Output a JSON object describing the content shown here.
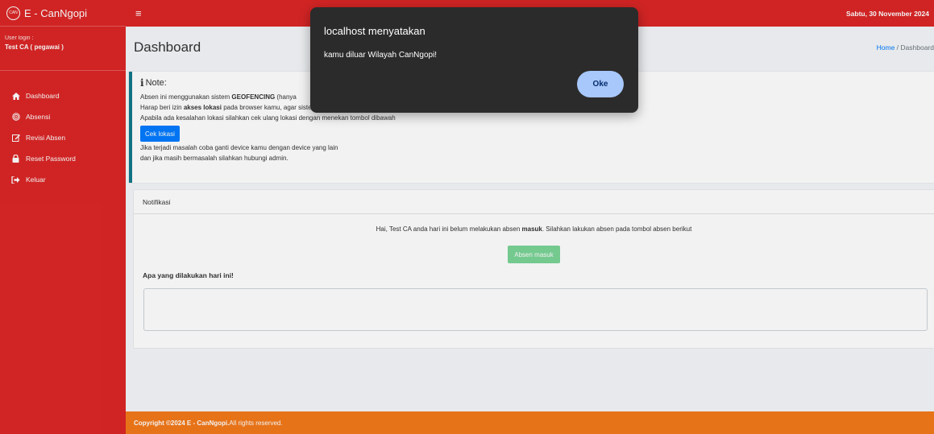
{
  "brand": {
    "name": "E - CanNgopi",
    "logo_text": "CAN"
  },
  "user": {
    "label": "User login :",
    "name": "Test CA ( pegawai )"
  },
  "nav": [
    {
      "label": "Dashboard",
      "icon": "home-icon"
    },
    {
      "label": "Absensi",
      "icon": "fingerprint-icon"
    },
    {
      "label": "Revisi Absen",
      "icon": "edit-icon"
    },
    {
      "label": "Reset Password",
      "icon": "lock-icon"
    },
    {
      "label": "Keluar",
      "icon": "sign-out-icon"
    }
  ],
  "topbar": {
    "date": "Sabtu, 30 November 2024"
  },
  "header": {
    "title": "Dashboard",
    "breadcrumb_home": "Home",
    "breadcrumb_sep": " / ",
    "breadcrumb_current": "Dashboard"
  },
  "note": {
    "title": "Note:",
    "line1_a": "Absen ini menggunakan sistem ",
    "line1_b": "GEOFENCING",
    "line1_c": " (hanya",
    "line2_a": "Harap beri izin ",
    "line2_b": "akses lokasi",
    "line2_c": " pada browser kamu, agar sistem bisa tau lokasi kamu",
    "line3": "Apabila ada kesalahan lokasi silahkan cek ulang lokasi dengan menekan tombol dibawah",
    "button": "Cek lokasi",
    "line4": "Jika terjadi masalah coba ganti device kamu dengan device yang lain",
    "line5": "dan jika masih bermasalah silahkan hubungi admin."
  },
  "notifikasi": {
    "header": "Notifikasi",
    "msg_a": "Hai, Test CA anda hari ini belum melakukan absen ",
    "msg_b": "masuk",
    "msg_c": ". Silahkan lakukan absen pada tombol absen berikut",
    "button": "Absen masuk",
    "question": "Apa yang dilakukan hari ini!",
    "textarea_value": ""
  },
  "footer": {
    "copyright": "Copyright ©2024 E - CanNgopi.",
    "rest": " All rights reserved."
  },
  "dialog": {
    "title": "localhost menyatakan",
    "message": "kamu diluar Wilayah CanNgopi!",
    "ok": "Oke"
  },
  "colors": {
    "primary_red": "#dc2626",
    "footer_orange": "#f47a1a",
    "callout_border": "#117a8b",
    "dialog_bg": "#2b2b2b",
    "dialog_btn": "#a8c7fa"
  }
}
